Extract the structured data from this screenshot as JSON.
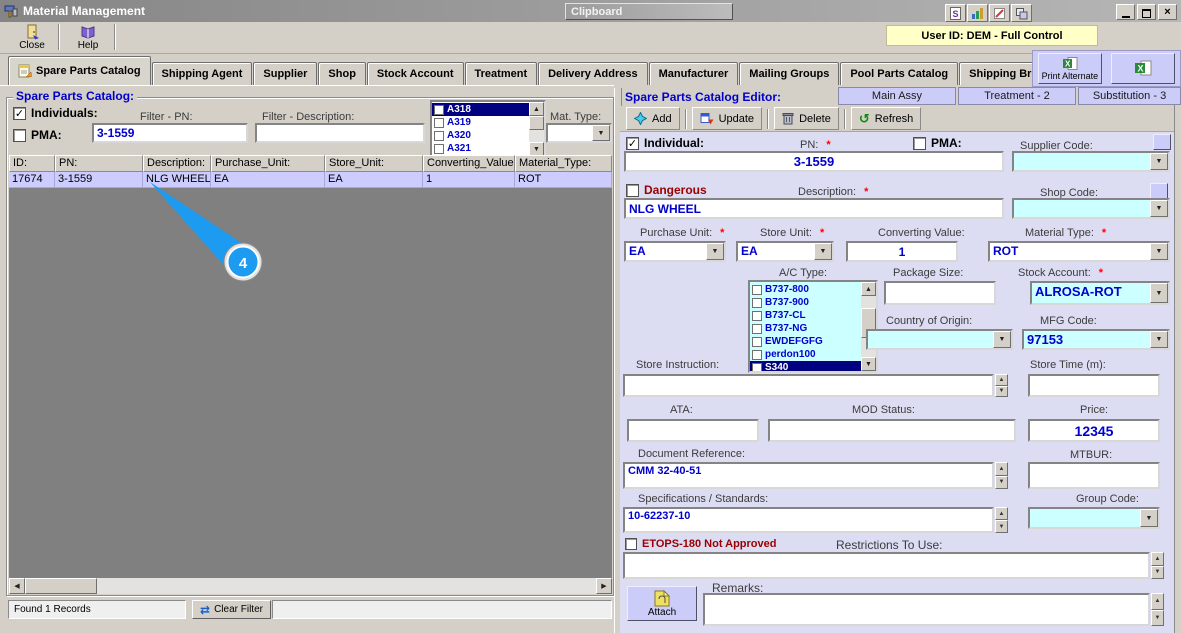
{
  "window": {
    "title": "Material Management",
    "clipboard_title": "Clipboard",
    "user_bar": "User ID: DEM - Full Control"
  },
  "icons": {
    "check": "✓",
    "dropdown_arrow": "▼",
    "spinner_up": "▲",
    "spinner_down": "▼",
    "scroll_left": "◀",
    "scroll_right": "▶",
    "scroll_up": "▲",
    "scroll_down": "▼",
    "refresh": "↺",
    "clear_filter": "⇄",
    "close_x": "×"
  },
  "toolbar": {
    "close_label": "Close",
    "help_label": "Help"
  },
  "tabs": [
    "Spare Parts Catalog",
    "Shipping Agent",
    "Supplier",
    "Shop",
    "Stock Account",
    "Treatment",
    "Delivery Address",
    "Manufacturer",
    "Mailing Groups",
    "Pool Parts Catalog",
    "Shipping Broker"
  ],
  "print_bar": {
    "print_alternate_label": "Print Alternate"
  },
  "left_panel": {
    "title": "Spare Parts Catalog:",
    "individuals_label": "Individuals:",
    "pma_label": "PMA:",
    "filter_pn_label": "Filter - PN:",
    "filter_pn_value": "3-1559",
    "filter_description_label": "Filter - Description:",
    "filter_description_value": "",
    "ac_filter_items": [
      "A318",
      "A319",
      "A320",
      "A321"
    ],
    "ac_filter_selected": "A318",
    "mat_type_label": "Mat. Type:",
    "mat_type_value": "",
    "table": {
      "columns": [
        "ID:",
        "PN:",
        "Description:",
        "Purchase_Unit:",
        "Store_Unit:",
        "Converting_Value:",
        "Material_Type:"
      ],
      "rows": [
        [
          "17674",
          "3-1559",
          "NLG WHEEL",
          "EA",
          "EA",
          "1",
          "ROT"
        ]
      ]
    },
    "status_text": "Found 1 Records",
    "clear_filter_label": "Clear Filter"
  },
  "callout": {
    "number": "4"
  },
  "editor": {
    "title": "Spare Parts Catalog Editor:",
    "tabs": [
      "Main Assy",
      "Treatment - 2",
      "Substitution - 3"
    ],
    "toolbar": {
      "add_label": "Add",
      "update_label": "Update",
      "delete_label": "Delete",
      "refresh_label": "Refresh"
    },
    "required_marker": "*",
    "individual_label": "Individual:",
    "pma_label": "PMA:",
    "pn": {
      "label": "PN:",
      "value": "3-1559"
    },
    "supplier_code_label": "Supplier Code:",
    "supplier_code_value": "",
    "dangerous_label": "Dangerous",
    "description": {
      "label": "Description:",
      "value": "NLG WHEEL"
    },
    "shop_code_label": "Shop Code:",
    "shop_code_value": "",
    "purchase_unit": {
      "label": "Purchase Unit:",
      "value": "EA"
    },
    "store_unit": {
      "label": "Store Unit:",
      "value": "EA"
    },
    "converting_value": {
      "label": "Converting Value:",
      "value": "1"
    },
    "material_type": {
      "label": "Material Type:",
      "value": "ROT"
    },
    "ac_type": {
      "label": "A/C Type:",
      "items": [
        "B737-800",
        "B737-900",
        "B737-CL",
        "B737-NG",
        "EWDEFGFG",
        "perdon100",
        "S340"
      ],
      "selected": "S340"
    },
    "package_size": {
      "label": "Package Size:",
      "value": ""
    },
    "stock_account": {
      "label": "Stock Account:",
      "value": "ALROSA-ROT"
    },
    "country_of_origin": {
      "label": "Country of Origin:",
      "value": ""
    },
    "mfg_code": {
      "label": "MFG Code:",
      "value": "97153"
    },
    "store_instruction": {
      "label": "Store Instruction:",
      "value": ""
    },
    "store_time": {
      "label": "Store Time (m):",
      "value": ""
    },
    "ata": {
      "label": "ATA:",
      "value": ""
    },
    "mod_status": {
      "label": "MOD Status:",
      "value": ""
    },
    "price": {
      "label": "Price:",
      "value": "12345"
    },
    "document_reference": {
      "label": "Document Reference:",
      "value": "CMM 32-40-51"
    },
    "mtbur": {
      "label": "MTBUR:",
      "value": ""
    },
    "specifications": {
      "label": "Specifications / Standards:",
      "value": "10-62237-10"
    },
    "group_code": {
      "label": "Group Code:",
      "value": ""
    },
    "etops_label": "ETOPS-180 Not Approved",
    "restrictions": {
      "label": "Restrictions To Use:",
      "value": ""
    },
    "attach_label": "Attach",
    "remarks": {
      "label": "Remarks:",
      "value": ""
    }
  },
  "colors": {
    "panel_lavender": "#dcdcf2",
    "button_lavender": "#ccccf8",
    "field_cyan": "#ccffff",
    "value_blue": "#0000cc",
    "selected_row": "#ccccff",
    "table_bg_gray": "#808080",
    "required_red": "#ff0000",
    "danger_maroon": "#990000",
    "user_bar_yellow": "#ffffc8",
    "callout_blue": "#1d9bf1",
    "highlight_navy": "#000080"
  }
}
